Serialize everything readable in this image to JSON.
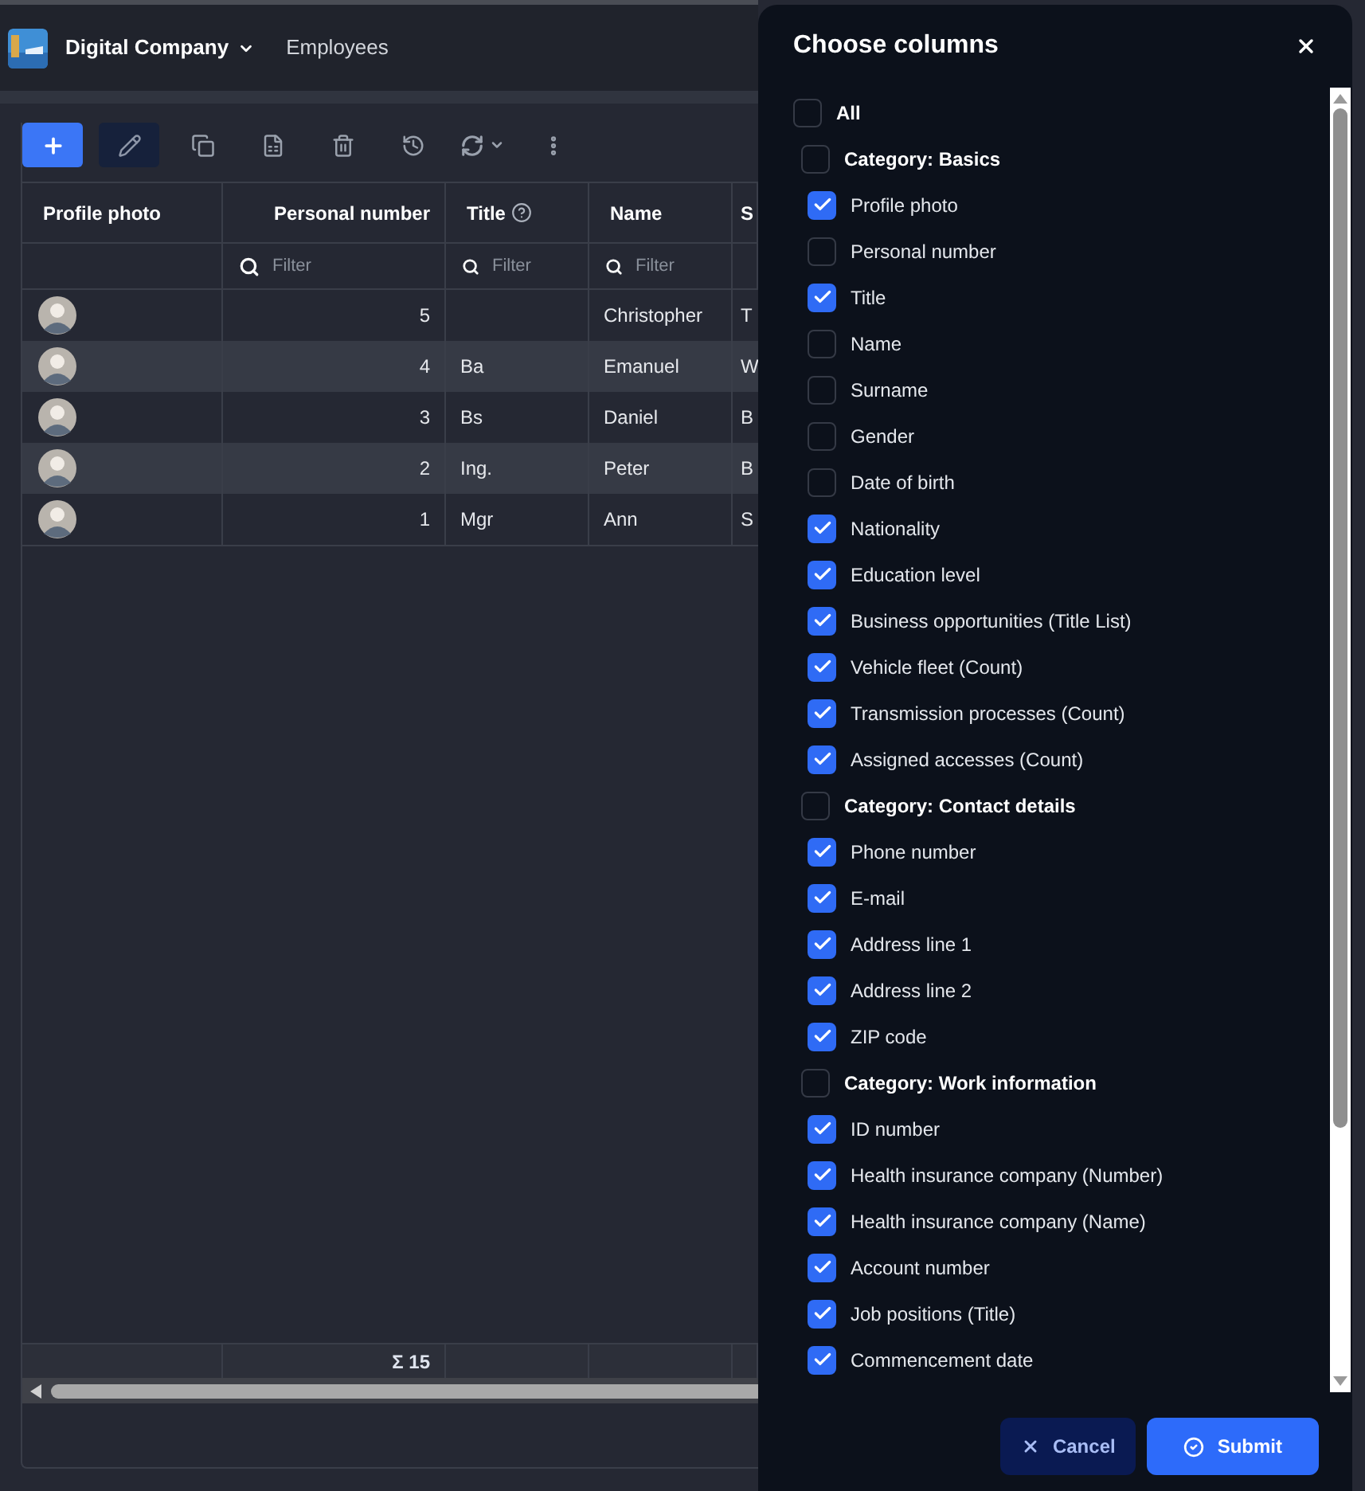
{
  "header": {
    "company": "Digital Company",
    "page": "Employees"
  },
  "toolbar": [
    {
      "kind": "add"
    },
    {
      "kind": "edit"
    },
    {
      "kind": "copy"
    },
    {
      "kind": "export"
    },
    {
      "kind": "delete"
    },
    {
      "kind": "history"
    },
    {
      "kind": "refresh"
    },
    {
      "kind": "more"
    }
  ],
  "table": {
    "columns": [
      {
        "label": "Profile photo",
        "hint": false
      },
      {
        "label": "Personal number",
        "hint": false,
        "filter": {
          "placeholder": "Filter"
        },
        "total": "Σ 15"
      },
      {
        "label": "Title",
        "hint": true,
        "filter": {
          "placeholder": "Filter"
        }
      },
      {
        "label": "Name",
        "hint": false,
        "filter": {
          "placeholder": "Filter"
        }
      },
      {
        "label": "S"
      }
    ],
    "rows": [
      {
        "number": "5",
        "title": "",
        "name": "Christopher",
        "column_5": "T"
      },
      {
        "number": "4",
        "title": "Ba",
        "name": "Emanuel",
        "column_5": "W"
      },
      {
        "number": "3",
        "title": "Bs",
        "name": "Daniel",
        "column_5": "B"
      },
      {
        "number": "2",
        "title": "Ing.",
        "name": "Peter",
        "column_5": "B"
      },
      {
        "number": "1",
        "title": "Mgr",
        "name": "Ann",
        "column_5": "S"
      }
    ]
  },
  "dialog": {
    "title": "Choose columns",
    "all": {
      "label": "All",
      "checked": false
    },
    "categories": [
      {
        "label": "Category: Basics",
        "checked": false,
        "children": [
          {
            "label": "Profile photo",
            "checked": true
          },
          {
            "label": "Personal number",
            "checked": false
          },
          {
            "label": "Title",
            "checked": true
          },
          {
            "label": "Name",
            "checked": false
          },
          {
            "label": "Surname",
            "checked": false
          },
          {
            "label": "Gender",
            "checked": false
          },
          {
            "label": "Date of birth",
            "checked": false
          },
          {
            "label": "Nationality",
            "checked": true
          },
          {
            "label": "Education level",
            "checked": true
          },
          {
            "label": "Business opportunities (Title List)",
            "checked": true
          },
          {
            "label": "Vehicle fleet (Count)",
            "checked": true
          },
          {
            "label": "Transmission processes (Count)",
            "checked": true
          },
          {
            "label": "Assigned accesses (Count)",
            "checked": true
          }
        ]
      },
      {
        "label": "Category: Contact details",
        "checked": false,
        "children": [
          {
            "label": "Phone number",
            "checked": true
          },
          {
            "label": "E-mail",
            "checked": true
          },
          {
            "label": "Address line 1",
            "checked": true
          },
          {
            "label": "Address line 2",
            "checked": true
          },
          {
            "label": "ZIP code",
            "checked": true
          }
        ]
      },
      {
        "label": "Category: Work information",
        "checked": false,
        "children": [
          {
            "label": "ID number",
            "checked": true
          },
          {
            "label": "Health insurance company (Number)",
            "checked": true
          },
          {
            "label": "Health insurance company (Name)",
            "checked": true
          },
          {
            "label": "Account number",
            "checked": true
          },
          {
            "label": "Job positions (Title)",
            "checked": true
          },
          {
            "label": "Commencement date",
            "checked": true
          }
        ]
      }
    ],
    "buttons": [
      {
        "kind": "cancel",
        "label": "Cancel"
      },
      {
        "kind": "submit",
        "label": "Submit"
      }
    ]
  }
}
